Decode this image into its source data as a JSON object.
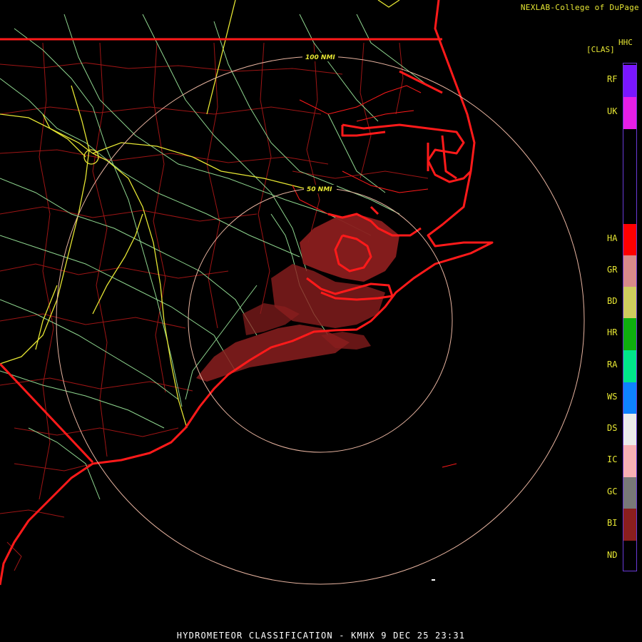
{
  "header": {
    "credit": "NEXLAB-College of DuPage",
    "product_code": "HHC",
    "product_subcode": "[CLAS]"
  },
  "range_rings": [
    {
      "label": "50 NMI"
    },
    {
      "label": "100 NMI"
    }
  ],
  "legend": {
    "items": [
      {
        "code": "RF",
        "color": "#7a16ff"
      },
      {
        "code": "UK",
        "color": "#e61ee6"
      },
      {
        "code": "HA",
        "color": "#ff0000"
      },
      {
        "code": "GR",
        "color": "#d88a8a"
      },
      {
        "code": "BD",
        "color": "#cfcb5e"
      },
      {
        "code": "HR",
        "color": "#0eae0e"
      },
      {
        "code": "RA",
        "color": "#00e68a"
      },
      {
        "code": "WS",
        "color": "#0e82ff"
      },
      {
        "code": "DS",
        "color": "#ebebeb"
      },
      {
        "code": "IC",
        "color": "#f7b0b4"
      },
      {
        "code": "GC",
        "color": "#787878"
      },
      {
        "code": "BI",
        "color": "#8a1e1e"
      },
      {
        "code": "ND",
        "color": "#000000"
      }
    ]
  },
  "colors": {
    "state_borders": "#ff1a1a",
    "county_lines": "#b01818",
    "interstates": "#e6e633",
    "highways": "#8fd68f",
    "range_rings": "#e8b4a0",
    "echo_class": "#8a1e1e"
  },
  "footer": {
    "product": "HYDROMETEOR CLASSIFICATION",
    "station": "KMHX",
    "datetime": "9 DEC 25 23:31",
    "text": "HYDROMETEOR CLASSIFICATION - KMHX 9 DEC 25 23:31"
  }
}
